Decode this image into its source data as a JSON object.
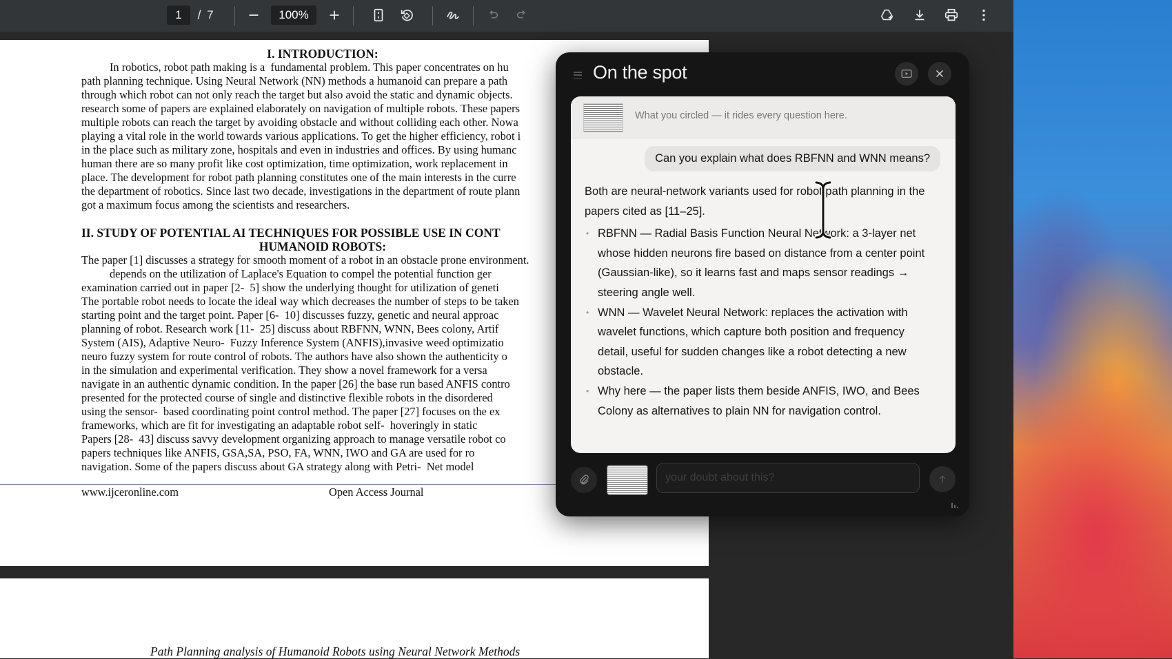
{
  "toolbar": {
    "current_page": "1",
    "page_separator": "/",
    "total_pages": "7",
    "zoom": "100%",
    "icons": [
      "minus-icon",
      "plus-icon",
      "fit-page-icon",
      "rotate-icon",
      "draw-icon",
      "undo-icon",
      "redo-icon",
      "add-to-drive-icon",
      "download-icon",
      "print-icon",
      "more-icon"
    ]
  },
  "document": {
    "heading1": "I.     INTRODUCTION:",
    "intro_lines": [
      "          In robotics, robot path making is a  fundamental problem. This paper concentrates on hu",
      "path planning technique. Using Neural Network (NN) methods a humanoid can prepare a path",
      "through which robot can not only reach the target but also avoid the static and dynamic objects.",
      "research some of papers are explained elaborately on navigation of multiple robots. These papers",
      "multiple robots can reach the target by avoiding obstacle and without colliding each other. Nowa",
      "playing a vital role in the world towards various applications. To get the higher efficiency, robot i",
      "in the place such as military zone, hospitals and even in industries and offices. By using humanc",
      "human there are so many profit like cost optimization, time optimization, work replacement in",
      "place. The development for robot path planning constitutes one of the main interests in the curre",
      "the department of robotics. Since last two decade, investigations in the department of route plann",
      "got a maximum focus among the scientists and researchers."
    ],
    "heading2_line1": "II.     STUDY OF POTENTIAL AI TECHNIQUES FOR POSSIBLE USE IN CONT",
    "heading2_line2": "HUMANOID  ROBOTS:",
    "study_lines": [
      "The paper [1] discusses a strategy for smooth moment of a robot in an obstacle prone environment.",
      "          depends on the utilization of Laplace's Equation to compel the potential function ger",
      "examination carried out in paper [2-  5] show the underlying thought for utilization of geneti",
      "The portable robot needs to locate the ideal way which decreases the number of steps to be taken",
      "starting point and the target point. Paper [6-  10] discusses fuzzy, genetic and neural approac",
      "planning of robot. Research work [11-  25] discuss about RBFNN, WNN, Bees colony, Artif",
      "System (AIS), Adaptive Neuro-  Fuzzy Inference System (ANFIS),invasive weed optimizatio",
      "neuro fuzzy system for route control of robots. The authors have also shown the authenticity o",
      "in the simulation and experimental verification. They show a novel framework for a versa",
      "navigate in an authentic dynamic condition. In the paper [26] the base run based ANFIS contro",
      "presented for the protected course of single and distinctive flexible robots in the disordered",
      "using the sensor-  based coordinating point control method. The paper [27] focuses on the ex",
      "frameworks, which are fit for investigating an adaptable robot self-  hoveringly in static",
      "Papers [28-  43] discuss savvy development organizing approach to manage versatile robot co",
      "papers techniques like ANFIS, GSA,SA, PSO, FA, WNN, IWO and GA are used for ro",
      "navigation. Some of the papers discuss about GA strategy along with Petri-  Net model"
    ],
    "footer_left": "www.ijceronline.com",
    "footer_center": "Open Access Journal",
    "page2_title": "Path Planning analysis of Humanoid Robots using Neural Network Methods"
  },
  "panel": {
    "title": "On the spot",
    "context_caption": "What you circled — it rides every question here.",
    "user_question": "Can you explain what does RBFNN and WNN means?",
    "answer_intro": "Both are neural-network variants used for robot path planning in the papers cited as [11–25].",
    "answer_bullets": [
      "RBFNN — Radial Basis Function Neural Network: a 3-layer net whose hidden neurons fire based on distance from a center point (Gaussian-like), so it learns fast and maps sensor readings → steering angle well.",
      "WNN — Wavelet Neural Network: replaces the activation with wavelet functions, which capture both position and frequency detail, useful for sudden changes like a robot detecting a new obstacle.",
      "Why here — the paper lists them beside ANFIS, IWO, and Bees Colony as alternatives to plain NN for navigation control."
    ],
    "input_placeholder": "your doubt about this?"
  }
}
